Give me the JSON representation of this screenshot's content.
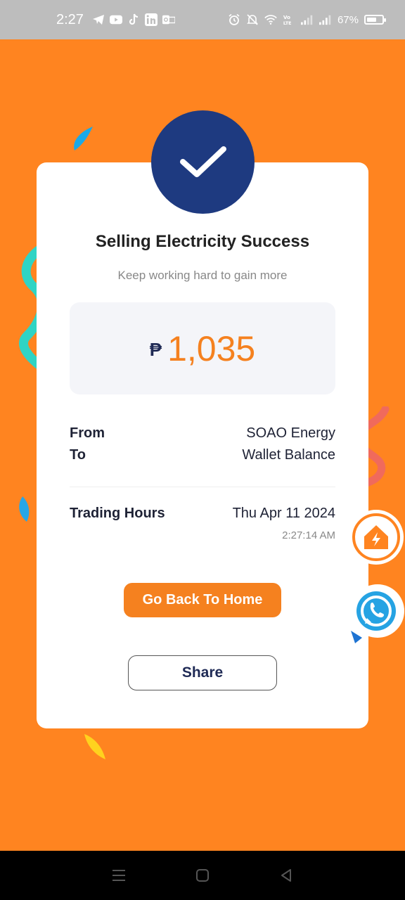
{
  "status_bar": {
    "time": "2:27",
    "battery_percent": "67%",
    "battery_level": 0.67,
    "notification_icons": [
      "telegram-icon",
      "youtube-icon",
      "tiktok-icon",
      "linkedin-icon",
      "outlook-icon"
    ],
    "system_icons": [
      "alarm-icon",
      "mute-icon",
      "wifi-icon",
      "volte-icon",
      "signal-icon",
      "signal-icon",
      "battery-icon"
    ]
  },
  "result": {
    "title": "Selling Electricity Success",
    "subtitle": "Keep working hard to gain more",
    "currency_symbol": "₱",
    "amount": "1,035"
  },
  "details": {
    "from_label": "From",
    "from_value": "SOAO Energy",
    "to_label": "To",
    "to_value": "Wallet Balance",
    "trading_hours_label": "Trading Hours",
    "trading_date": "Thu Apr 11 2024",
    "trading_time": "2:27:14 AM"
  },
  "actions": {
    "home_label": "Go Back To Home",
    "share_label": "Share"
  },
  "floating": {
    "home": "home-energy-icon",
    "chat": "whatsapp-icon"
  },
  "colors": {
    "background": "#ff8420",
    "accent": "#f5811f",
    "navy": "#1e3a80"
  }
}
